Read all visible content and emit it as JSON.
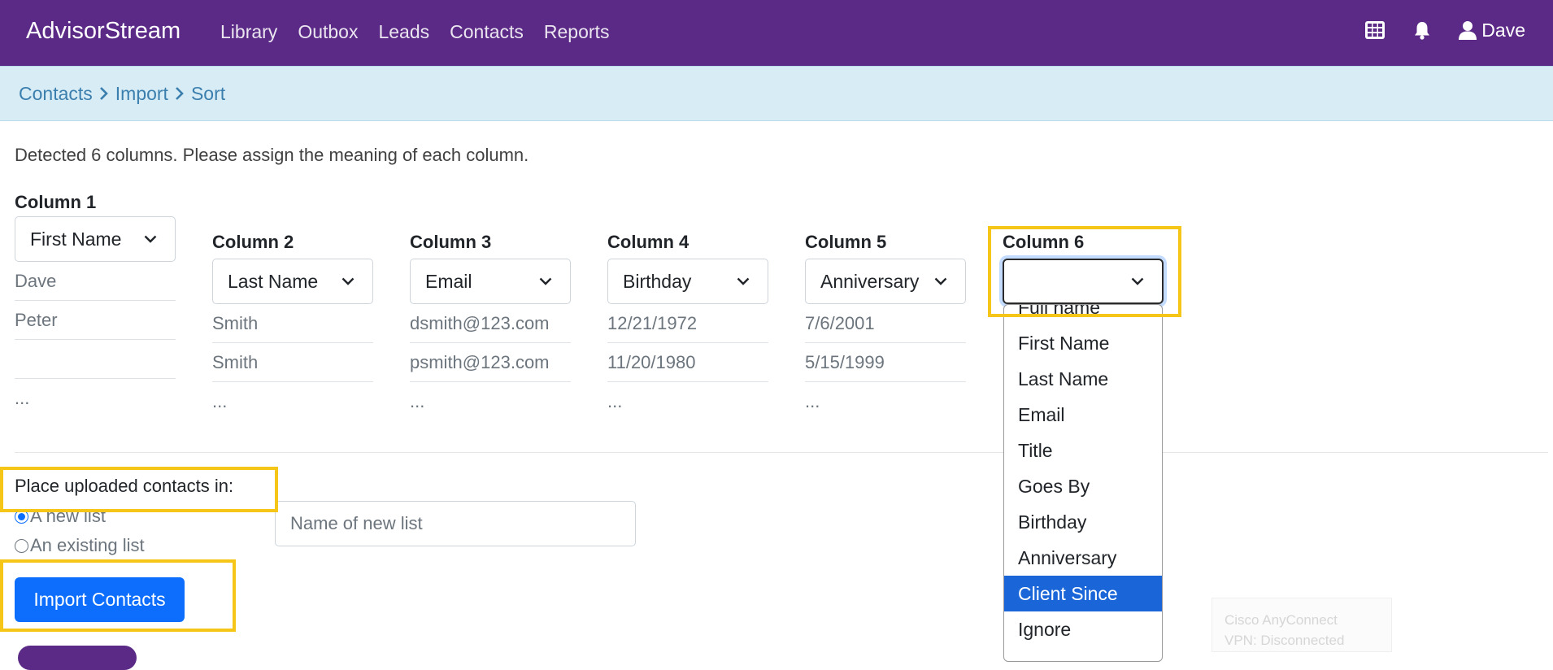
{
  "navbar": {
    "brand": "AdvisorStream",
    "links": [
      "Library",
      "Outbox",
      "Leads",
      "Contacts",
      "Reports"
    ],
    "user_name": "Dave",
    "background_color": "#5b2a86"
  },
  "breadcrumb": {
    "items": [
      "Contacts",
      "Import",
      "Sort"
    ]
  },
  "intro_text": "Detected 6 columns. Please assign the meaning of each column.",
  "columns": [
    {
      "title": "Column 1",
      "selected": "First Name",
      "cells": [
        "Dave",
        "Peter",
        "",
        "..."
      ]
    },
    {
      "title": "Column 2",
      "selected": "Last Name",
      "cells": [
        "Smith",
        "Smith",
        "..."
      ]
    },
    {
      "title": "Column 3",
      "selected": "Email",
      "cells": [
        "dsmith@123.com",
        "psmith@123.com",
        "..."
      ]
    },
    {
      "title": "Column 4",
      "selected": "Birthday",
      "cells": [
        "12/21/1972",
        "11/20/1980",
        "..."
      ]
    },
    {
      "title": "Column 5",
      "selected": "Anniversary",
      "cells": [
        "7/6/2001",
        "5/15/1999",
        "..."
      ]
    },
    {
      "title": "Column 6",
      "selected": ""
    }
  ],
  "column6_dropdown": {
    "options": [
      "Full name",
      "First Name",
      "Last Name",
      "Email",
      "Title",
      "Goes By",
      "Birthday",
      "Anniversary",
      "Client Since",
      "Ignore"
    ],
    "highlighted_option": "Client Since",
    "highlight_color": "#1a66d8"
  },
  "placement": {
    "label": "Place uploaded contacts in:",
    "options": [
      "A new list",
      "An existing list"
    ],
    "checked_option": "A new list",
    "list_name_placeholder": "Name of new list"
  },
  "import_button_label": "Import Contacts",
  "vpn_toast": {
    "line1": "Cisco AnyConnect",
    "line2": "VPN: Disconnected"
  },
  "highlight_color": "#f5c518"
}
